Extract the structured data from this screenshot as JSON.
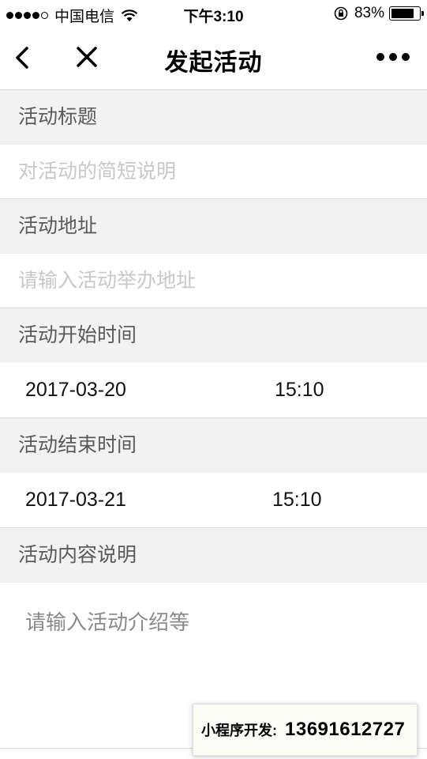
{
  "status_bar": {
    "carrier": "中国电信",
    "time": "下午3:10",
    "battery_percent": "83%",
    "battery_level": 0.83,
    "signal_bars": 4,
    "icons": [
      "signal-icon",
      "wifi-icon",
      "rotation-lock-icon",
      "battery-icon"
    ]
  },
  "nav": {
    "title": "发起活动",
    "icons": [
      "back-icon",
      "close-icon",
      "more-icon"
    ]
  },
  "form": {
    "title_label": "活动标题",
    "title_placeholder": "对活动的简短说明",
    "address_label": "活动地址",
    "address_placeholder": "请输入活动举办地址",
    "start_label": "活动开始时间",
    "start_date": "2017-03-20",
    "start_time": "15:10",
    "end_label": "活动结束时间",
    "end_date": "2017-03-21",
    "end_time": "15:10",
    "content_label": "活动内容说明",
    "content_placeholder": "请输入活动介绍等"
  },
  "badge": {
    "label": "小程序开发:",
    "phone": "13691612727"
  },
  "colors": {
    "section_bg": "#f2f2f2",
    "placeholder": "#c8c8c8",
    "label_text": "#5a5a5a"
  }
}
